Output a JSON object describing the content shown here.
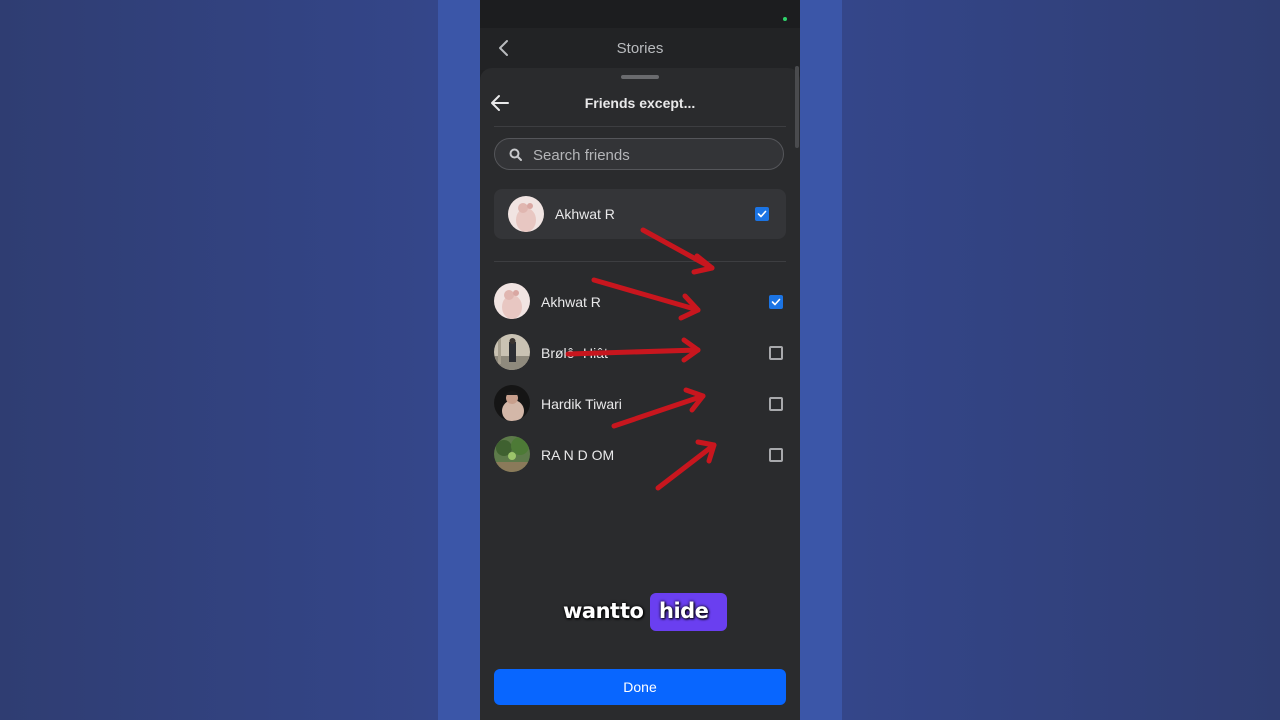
{
  "topbar": {
    "title": "Stories"
  },
  "sheet": {
    "title": "Friends except..."
  },
  "search": {
    "placeholder": "Search friends"
  },
  "selected": [
    {
      "name": "Akhwat R",
      "checked": true
    }
  ],
  "friends": [
    {
      "name": "Akhwat R",
      "checked": true
    },
    {
      "name": "Brølê· Hiât",
      "checked": false
    },
    {
      "name": "Hardik Tiwari",
      "checked": false
    },
    {
      "name": "RA N D OM",
      "checked": false
    }
  ],
  "done_label": "Done",
  "caption": {
    "word1": "want",
    "word2": "to",
    "word3": "hide"
  },
  "colors": {
    "accent": "#0866ff",
    "checkbox": "#1b74e4",
    "arrow": "#c8161e",
    "highlight": "#6a3ff0"
  }
}
